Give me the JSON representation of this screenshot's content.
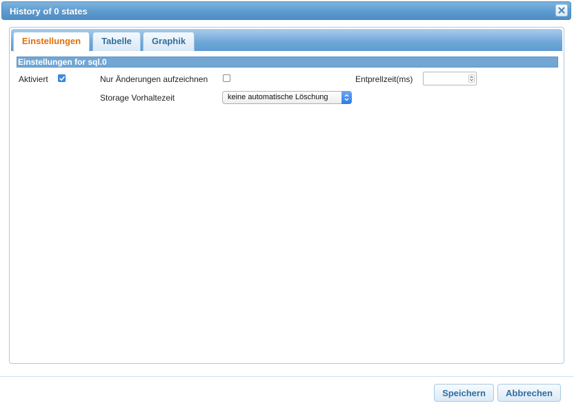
{
  "dialog": {
    "title": "History of 0 states"
  },
  "tabs": [
    {
      "label": "Einstellungen",
      "active": true
    },
    {
      "label": "Tabelle",
      "active": false
    },
    {
      "label": "Graphik",
      "active": false
    }
  ],
  "settings": {
    "section_title": "Einstellungen for sql.0",
    "enabled_label": "Aktiviert",
    "enabled_checked": true,
    "changes_only_label": "Nur Änderungen aufzeichnen",
    "changes_only_checked": false,
    "debounce_label": "Entprellzeit(ms)",
    "debounce_value": "",
    "retention_label": "Storage Vorhaltezeit",
    "retention_value": "keine automatische Löschung"
  },
  "footer": {
    "save_label": "Speichern",
    "cancel_label": "Abbrechen"
  },
  "colors": {
    "titlebar": "#5c9bd0",
    "active_tab_text": "#e17009",
    "tab_text": "#2e6e9e",
    "section_header": "#72a6d3",
    "checkbox_checked": "#3b8ee8"
  }
}
